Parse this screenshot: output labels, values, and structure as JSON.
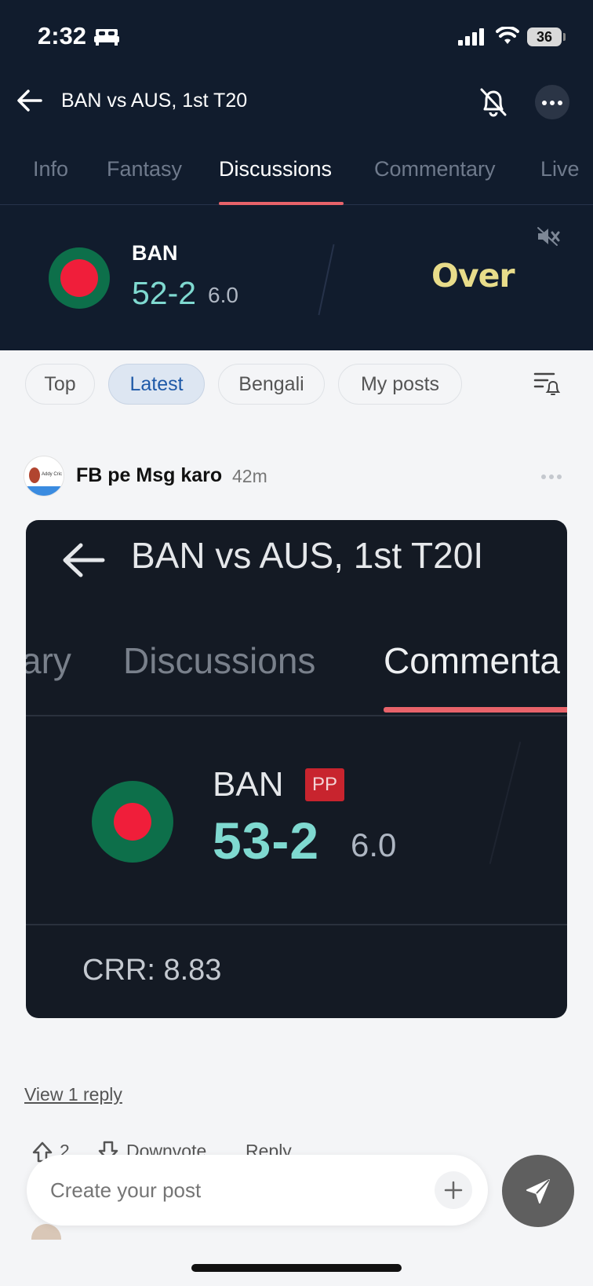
{
  "status_bar": {
    "time": "2:32",
    "battery": "36"
  },
  "header": {
    "title": "BAN vs AUS, 1st T20"
  },
  "tabs": [
    {
      "label": "Info"
    },
    {
      "label": "Fantasy"
    },
    {
      "label": "Discussions"
    },
    {
      "label": "Commentary"
    },
    {
      "label": "Live"
    }
  ],
  "score": {
    "team": "BAN",
    "score": "52-2",
    "overs": "6.0",
    "status": "Over"
  },
  "filters": [
    {
      "label": "Top"
    },
    {
      "label": "Latest"
    },
    {
      "label": "Bengali"
    },
    {
      "label": "My posts"
    }
  ],
  "post": {
    "author": "FB pe Msg karo",
    "time": "42m",
    "avatar_text": "Addy Cric",
    "image": {
      "title": "BAN vs AUS, 1st T20I",
      "tabs": [
        "ary",
        "Discussions",
        "Commenta"
      ],
      "team": "BAN",
      "badge": "PP",
      "score": "53-2",
      "overs": "6.0",
      "crr": "CRR: 8.83"
    },
    "view_reply": "View 1 reply",
    "upvotes": "2",
    "downvote_label": "Downvote",
    "reply_label": "Reply"
  },
  "composer": {
    "placeholder": "Create your post"
  },
  "colors": {
    "header_bg": "#111c2d",
    "accent": "#e8636a",
    "score": "#7fd9d0",
    "over": "#e8dc8a",
    "chip_active": "#1f5aa8"
  }
}
